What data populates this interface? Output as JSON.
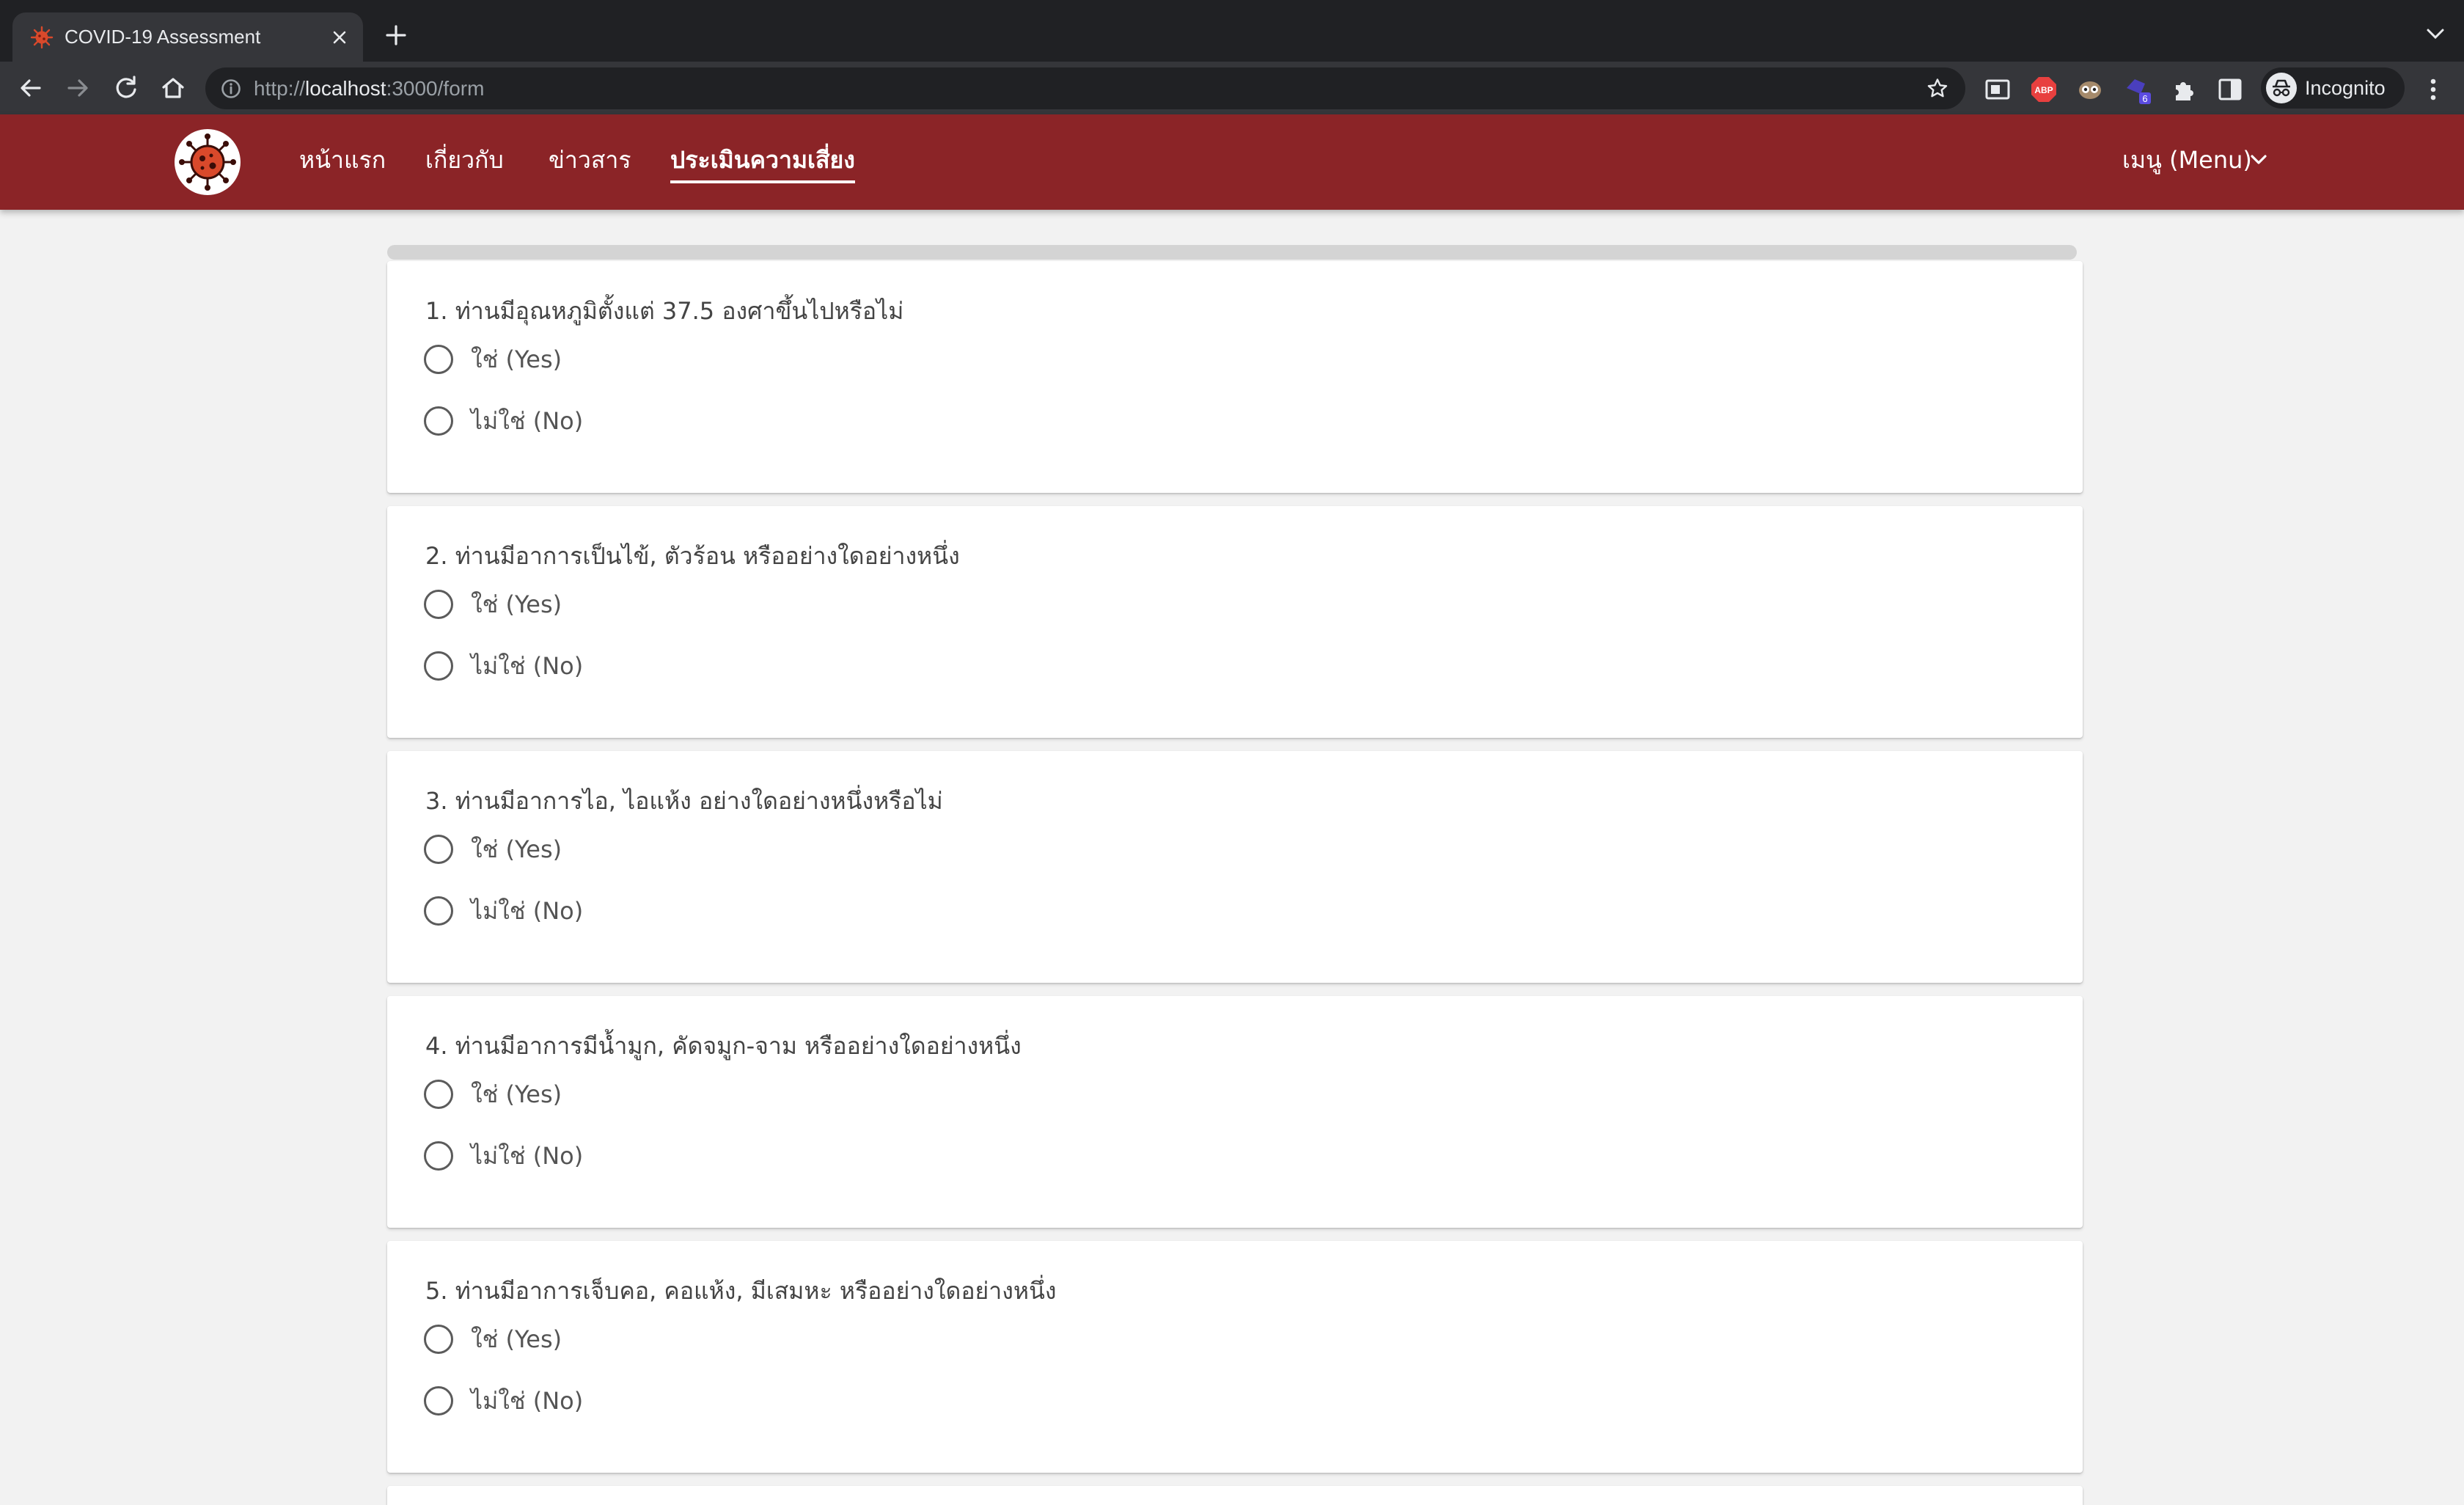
{
  "browser": {
    "tab_title": "COVID-19 Assessment",
    "url_scheme": "http://",
    "url_host": "localhost",
    "url_path": ":3000/form",
    "extension_badge": "6",
    "incognito_label": "Incognito"
  },
  "header": {
    "nav": [
      {
        "label": "หน้าแรก"
      },
      {
        "label": "เกี่ยวกับ"
      },
      {
        "label": "ข่าวสาร"
      },
      {
        "label": "ประเมินความเสี่ยง",
        "active": true
      }
    ],
    "menu_label": "เมนู (Menu)",
    "brand_color": "#8b2427"
  },
  "form": {
    "progress": 0,
    "questions": [
      {
        "text": "1. ท่านมีอุณหภูมิตั้งแต่ 37.5 องศาขึ้นไปหรือไม่",
        "yes": "ใช่ (Yes)",
        "no": "ไม่ใช่ (No)"
      },
      {
        "text": "2. ท่านมีอาการเป็นไข้, ตัวร้อน หรืออย่างใดอย่างหนึ่ง",
        "yes": "ใช่ (Yes)",
        "no": "ไม่ใช่ (No)"
      },
      {
        "text": "3. ท่านมีอาการไอ, ไอแห้ง อย่างใดอย่างหนึ่งหรือไม่",
        "yes": "ใช่ (Yes)",
        "no": "ไม่ใช่ (No)"
      },
      {
        "text": "4. ท่านมีอาการมีน้ำมูก, คัดจมูก-จาม หรืออย่างใดอย่างหนึ่ง",
        "yes": "ใช่ (Yes)",
        "no": "ไม่ใช่ (No)"
      },
      {
        "text": "5. ท่านมีอาการเจ็บคอ, คอแห้ง, มีเสมหะ หรืออย่างใดอย่างหนึ่ง",
        "yes": "ใช่ (Yes)",
        "no": "ไม่ใช่ (No)"
      }
    ]
  },
  "icons": {
    "tab_favicon": "virus-icon",
    "logo": "virus-icon",
    "omnibox_info": "info-icon",
    "bookmark": "star-icon"
  }
}
